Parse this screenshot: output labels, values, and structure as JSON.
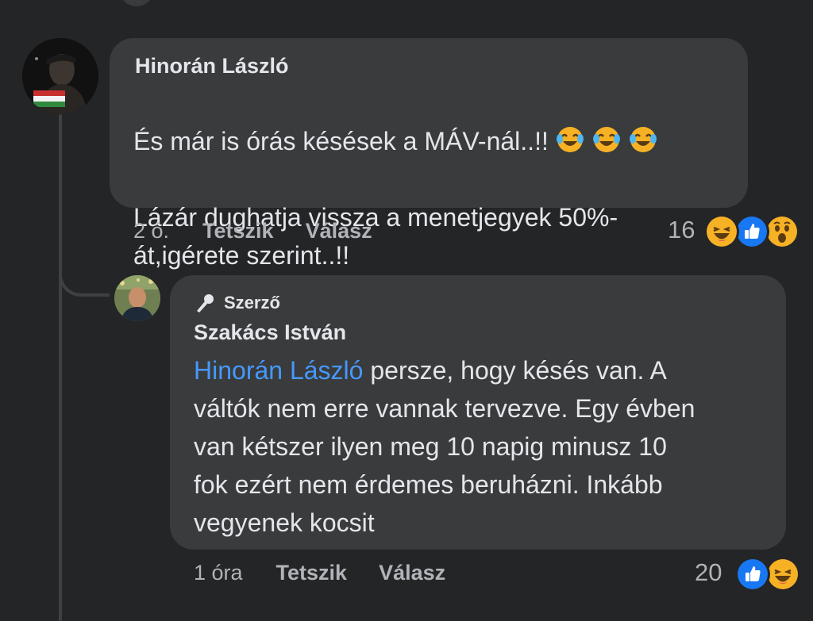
{
  "comments": [
    {
      "author": "Hinorán László",
      "text": "És már is órás késések a MÁV-nál..!!",
      "text_line2": "Lázár dughatja vissza a menetjegyek 50%-\nát,igérete szerint..!!",
      "inline_emojis": [
        "tears-of-joy-emoji",
        "tears-of-joy-emoji",
        "tears-of-joy-emoji"
      ],
      "time": "2 ó.",
      "like_label": "Tetszik",
      "reply_label": "Válasz",
      "reaction_count": "16",
      "reactions": [
        "haha-reaction-icon",
        "like-reaction-icon",
        "wow-reaction-icon"
      ]
    },
    {
      "badge": "Szerző",
      "author": "Szakács István",
      "mention": "Hinorán László",
      "text": " persze, hogy késés van. A\nváltók nem erre vannak tervezve. Egy évben\nvan kétszer ilyen meg 10 napig minusz 10\nfok ezért nem érdemes beruházni. Inkább\nvegyenek kocsit",
      "time": "1 óra",
      "like_label": "Tetszik",
      "reply_label": "Válasz",
      "reaction_count": "20",
      "reactions": [
        "like-reaction-icon",
        "haha-reaction-icon"
      ]
    }
  ],
  "colors": {
    "background": "#242526",
    "bubble": "#3a3b3c",
    "text": "#e4e6eb",
    "secondary_text": "#b0b3b8",
    "mention": "#4599ff",
    "like_blue": "#1877f2",
    "emoji_yellow": "#f7b125"
  }
}
